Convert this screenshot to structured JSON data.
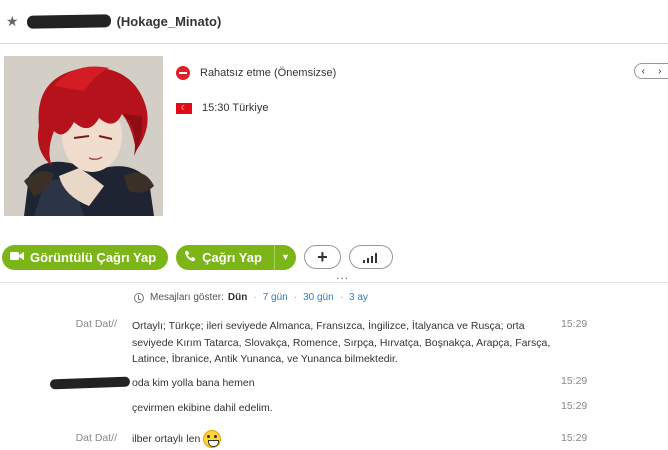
{
  "header": {
    "contact_name": "(Hokage_Minato)"
  },
  "profile": {
    "status_text": "Rahatsız etme (Önemsizse)",
    "local_time": "15:30 Türkiye",
    "pager_prev": "‹",
    "pager_next": "›"
  },
  "actions": {
    "video_call_label": "Görüntülü Çağrı Yap",
    "call_label": "Çağrı Yap",
    "add_label": "+",
    "more_label": "..."
  },
  "history": {
    "label": "Mesajları göster:",
    "options": [
      "Dün",
      "7 gün",
      "30 gün",
      "3 ay"
    ]
  },
  "messages": [
    {
      "sender": "Dat Dat//",
      "text": "Ortaylı; Türkçe; ileri seviyede Almanca, Fransızca, İngilizce, İtalyanca ve Rusça; orta seviyede Kırım Tatarca, Slovakça, Romence, Sırpça, Hırvatça, Boşnakça, Arapça, Farsça, Latince, İbranice, Antik Yunanca, ve Yunanca bilmektedir.",
      "time": "15:29"
    },
    {
      "sender": "",
      "text": "oda kim yolla bana hemen",
      "time": "15:29"
    },
    {
      "sender": "",
      "text": "çevirmen ekibine dahil edelim.",
      "time": "15:29"
    },
    {
      "sender": "Dat Dat//",
      "text": "ilber ortaylı len",
      "time": "15:29",
      "emoji": "grin-emoji"
    }
  ],
  "colors": {
    "call_green": "#7cb518",
    "link_blue": "#2a7fc2",
    "status_red": "#e0202a"
  }
}
